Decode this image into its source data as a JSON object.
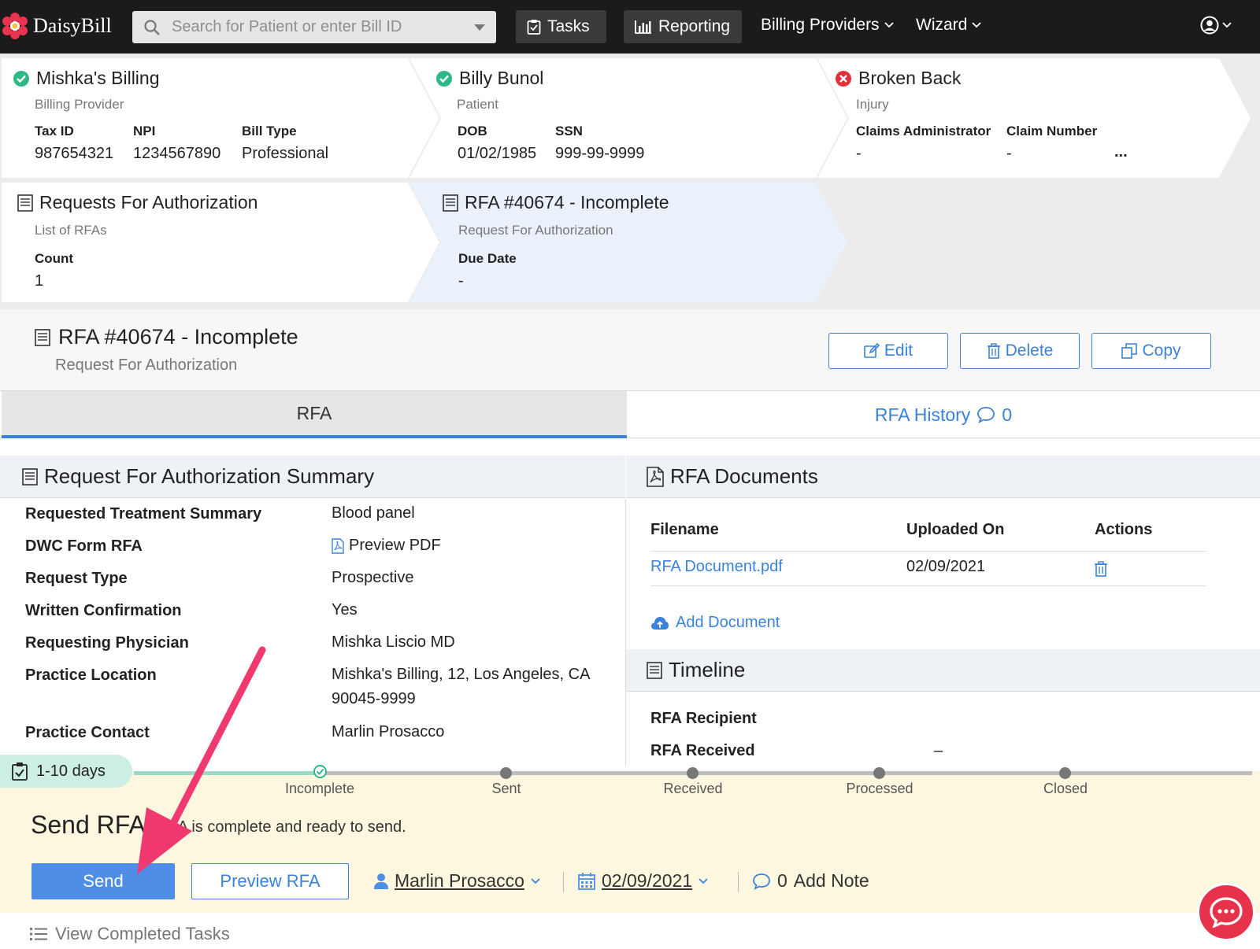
{
  "nav": {
    "brand": "DaisyBill",
    "search_placeholder": "Search for Patient or enter Bill ID",
    "tasks": "Tasks",
    "reporting": "Reporting",
    "billing_providers": "Billing Providers",
    "wizard": "Wizard"
  },
  "cards": {
    "billing": {
      "title": "Mishka's Billing",
      "subtitle": "Billing Provider",
      "tax_id_label": "Tax ID",
      "tax_id": "987654321",
      "npi_label": "NPI",
      "npi": "1234567890",
      "bill_type_label": "Bill Type",
      "bill_type": "Professional"
    },
    "patient": {
      "title": "Billy Bunol",
      "subtitle": "Patient",
      "dob_label": "DOB",
      "dob": "01/02/1985",
      "ssn_label": "SSN",
      "ssn": "999-99-9999"
    },
    "injury": {
      "title": "Broken Back",
      "subtitle": "Injury",
      "admin_label": "Claims Administrator",
      "admin": "-",
      "claim_label": "Claim Number",
      "claim": "-",
      "more": "..."
    },
    "rfas": {
      "title": "Requests For Authorization",
      "subtitle": "List of RFAs",
      "count_label": "Count",
      "count": "1"
    },
    "rfa": {
      "title": "RFA #40674 - Incomplete",
      "subtitle": "Request For Authorization",
      "due_label": "Due Date",
      "due": "-"
    }
  },
  "record": {
    "title": "RFA #40674 - Incomplete",
    "subtitle": "Request For Authorization",
    "edit": "Edit",
    "delete": "Delete",
    "copy": "Copy"
  },
  "tabs": {
    "rfa": "RFA",
    "history": "RFA History",
    "history_count": "0"
  },
  "summary": {
    "title": "Request For Authorization Summary",
    "rows": [
      {
        "label": "Requested Treatment Summary",
        "value": "Blood panel"
      },
      {
        "label": "DWC Form RFA",
        "value": "Preview PDF"
      },
      {
        "label": "Request Type",
        "value": "Prospective"
      },
      {
        "label": "Written Confirmation",
        "value": "Yes"
      },
      {
        "label": "Requesting Physician",
        "value": "Mishka Liscio MD"
      },
      {
        "label": "Practice Location",
        "value": "Mishka's Billing, 12, Los Angeles, CA 90045-9999"
      },
      {
        "label": "Practice Contact",
        "value": "Marlin Prosacco"
      }
    ]
  },
  "documents": {
    "title": "RFA Documents",
    "headers": [
      "Filename",
      "Uploaded On",
      "Actions"
    ],
    "rows": [
      {
        "filename": "RFA Document.pdf",
        "uploaded": "02/09/2021"
      }
    ],
    "add": "Add Document"
  },
  "timeline": {
    "title": "Timeline",
    "recipient_label": "RFA Recipient",
    "received_label": "RFA Received",
    "received_value": "–"
  },
  "task": {
    "duration": "1-10 days",
    "steps": [
      "Incomplete",
      "Sent",
      "Received",
      "Processed",
      "Closed"
    ],
    "title": "Send RFA",
    "description": "RFA is complete and ready to send.",
    "send": "Send",
    "preview": "Preview RFA",
    "assignee": "Marlin Prosacco",
    "date": "02/09/2021",
    "note_count": "0",
    "note": "Add Note",
    "view_completed": "View Completed Tasks"
  },
  "colors": {
    "accent": "#3b82d9",
    "success": "#2eb886",
    "error": "#e0303a",
    "arrow": "#f0396e",
    "chat": "#e6324b"
  }
}
